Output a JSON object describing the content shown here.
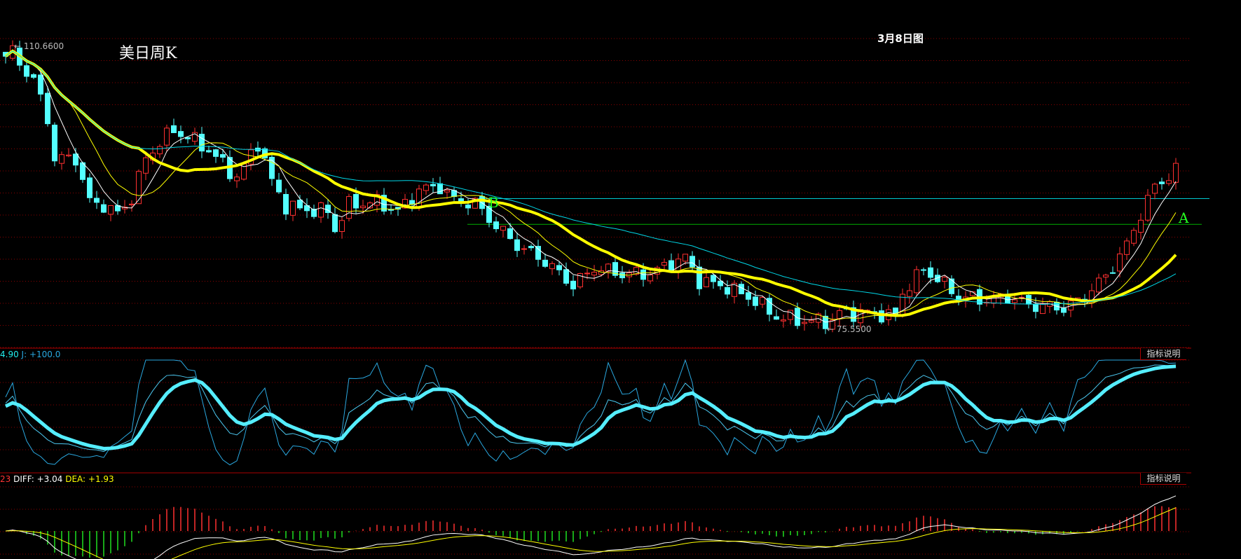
{
  "chart_data": {
    "type": "candlestick",
    "title": "美日周K",
    "subtitle": "3月8日图",
    "high_label": "110.6600",
    "low_label": "75.5500",
    "price_range": [
      75.55,
      110.66
    ],
    "close_keypoints": {
      "week": [
        0,
        1,
        2,
        4,
        6,
        7,
        10,
        12,
        14,
        16,
        18,
        20,
        22,
        24,
        27,
        29,
        33,
        36,
        38,
        40,
        42,
        46,
        47,
        49,
        53,
        56,
        59,
        62,
        64,
        67,
        70,
        73,
        77,
        81,
        84,
        88,
        92,
        97,
        99,
        103,
        107,
        110,
        114,
        118,
        119,
        124,
        127,
        128,
        131,
        133,
        136,
        140,
        143,
        146,
        151,
        153,
        157,
        160,
        162,
        164,
        167
      ],
      "close": [
        109.5,
        110.1,
        108.6,
        106.6,
        101.7,
        96.8,
        96.8,
        91.4,
        91.0,
        89.9,
        91.9,
        96.8,
        98.8,
        100.3,
        99.0,
        97.8,
        94.4,
        98.8,
        94.0,
        90.9,
        90.5,
        90.2,
        88.0,
        91.0,
        91.4,
        90.2,
        92.9,
        93.3,
        91.6,
        91.2,
        88.4,
        86.0,
        84.0,
        81.0,
        83.2,
        82.4,
        82.5,
        84.5,
        81.6,
        80.8,
        79.1,
        77.1,
        76.6,
        76.6,
        77.6,
        77.6,
        77.1,
        80.1,
        83.0,
        81.8,
        79.6,
        79.2,
        79.6,
        78.6,
        78.2,
        79.0,
        82.1,
        86.0,
        89.9,
        93.3,
        95.3
      ]
    },
    "moving_averages": [
      {
        "period": 5,
        "color": "#ffffff"
      },
      {
        "period": 10,
        "color": "#ffff00"
      },
      {
        "period": 20,
        "color": "#ffff00"
      },
      {
        "period": 40,
        "color": "#00d8e8"
      }
    ],
    "levels": [
      {
        "name": "B",
        "price": 91.8,
        "color": "#00c8d0"
      },
      {
        "name": "A",
        "price": 88.6,
        "color": "#00b000"
      }
    ],
    "kdj": {
      "label_partial": "4.90",
      "j_label": "J: +100.0",
      "range": [
        0,
        100
      ]
    },
    "macd": {
      "label_partial": "23",
      "diff_label": "DIFF: +3.04",
      "dea_label": "DEA: +1.93"
    },
    "indicator_button": "指标说明",
    "up_color": "#ff3030",
    "down_color": "#54ffff"
  }
}
